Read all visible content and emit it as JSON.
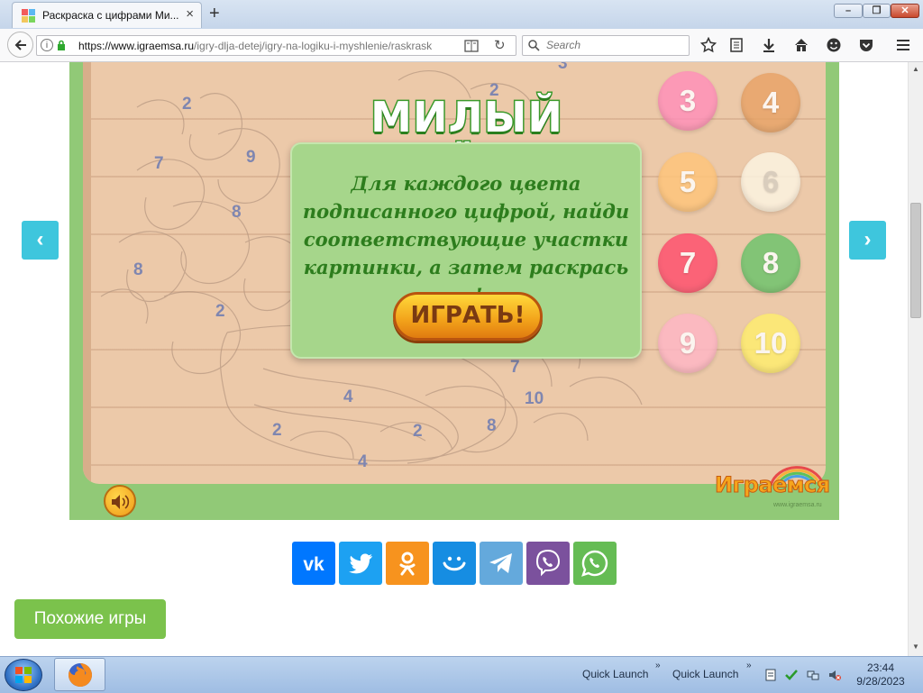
{
  "browser": {
    "tab_title": "Раскраска с цифрами Ми...",
    "tab_close": "×",
    "new_tab": "+",
    "url_host": "https://www.igraemsa.ru",
    "url_path": "/igry-dlja-detej/igry-na-logiku-i-myshlenie/raskrask",
    "search_placeholder": "Search",
    "window_buttons": [
      "–",
      "❐",
      "✕"
    ]
  },
  "game": {
    "title": "МИЛЫЙ КОТЁНОК",
    "instructions": "Для каждого цвета подписанного цифрой, найди соответствующие участки картинки, а затем раскрась их!",
    "play_label": "ИГРАТЬ!",
    "brand": "Играемся",
    "brand_url": "www.igraemsa.ru",
    "picture_numbers": [
      "3",
      "2",
      "2",
      "7",
      "9",
      "8",
      "8",
      "2",
      "7",
      "4",
      "10",
      "2",
      "2",
      "8",
      "4"
    ],
    "palette": [
      {
        "label": "3",
        "color": "#ff8fb9"
      },
      {
        "label": "4",
        "color": "#e8a366"
      },
      {
        "label": "5",
        "color": "#ffc57a"
      },
      {
        "label": "6",
        "color": "#fdf5e3"
      },
      {
        "label": "7",
        "color": "#ff4d6d"
      },
      {
        "label": "8",
        "color": "#6bc46b"
      },
      {
        "label": "9",
        "color": "#ffb6c6"
      },
      {
        "label": "10",
        "color": "#ffee6e"
      }
    ]
  },
  "nav": {
    "prev": "‹",
    "next": "›"
  },
  "share": [
    {
      "name": "vk",
      "color": "#0077ff"
    },
    {
      "name": "twitter",
      "color": "#1da1f2"
    },
    {
      "name": "odnoklassniki",
      "color": "#f7931e"
    },
    {
      "name": "moimir",
      "color": "#168de2"
    },
    {
      "name": "telegram",
      "color": "#64a9dc"
    },
    {
      "name": "viber",
      "color": "#7b519d"
    },
    {
      "name": "whatsapp",
      "color": "#65bc54"
    }
  ],
  "similar_games": "Похожие игры",
  "taskbar": {
    "quick_launch_1": "Quick Launch",
    "quick_launch_2": "Quick Launch",
    "time": "23:44",
    "date": "9/28/2023"
  }
}
